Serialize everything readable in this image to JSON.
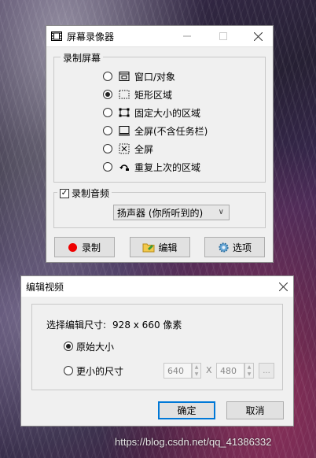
{
  "recorder": {
    "title": "屏幕录像器",
    "capture_group": "录制屏幕",
    "options": [
      {
        "label": "窗口/对象",
        "icon": "window-icon",
        "selected": false
      },
      {
        "label": "矩形区域",
        "icon": "dashed-rect-icon",
        "selected": true
      },
      {
        "label": "固定大小的区域",
        "icon": "fixed-size-icon",
        "selected": false
      },
      {
        "label": "全屏(不含任务栏)",
        "icon": "monitor-icon",
        "selected": false
      },
      {
        "label": "全屏",
        "icon": "fullscreen-icon",
        "selected": false
      },
      {
        "label": "重复上次的区域",
        "icon": "repeat-icon",
        "selected": false
      }
    ],
    "audio_label": "录制音频",
    "audio_checked": true,
    "audio_source": "扬声器 (你所听到的)",
    "buttons": {
      "record": "录制",
      "edit": "编辑",
      "options": "选项"
    }
  },
  "edit_dialog": {
    "title": "编辑视频",
    "size_label": "选择编辑尺寸:",
    "size_value": "928 x 660 像素",
    "original_label": "原始大小",
    "original_selected": true,
    "smaller_label": "更小的尺寸",
    "width": "640",
    "times": "X",
    "height": "480",
    "browse": "...",
    "ok": "确定",
    "cancel": "取消"
  },
  "watermark": "https://blog.csdn.net/qq_41386332",
  "colors": {
    "record_dot": "#ee0000",
    "ok_border": "#0078d7"
  }
}
